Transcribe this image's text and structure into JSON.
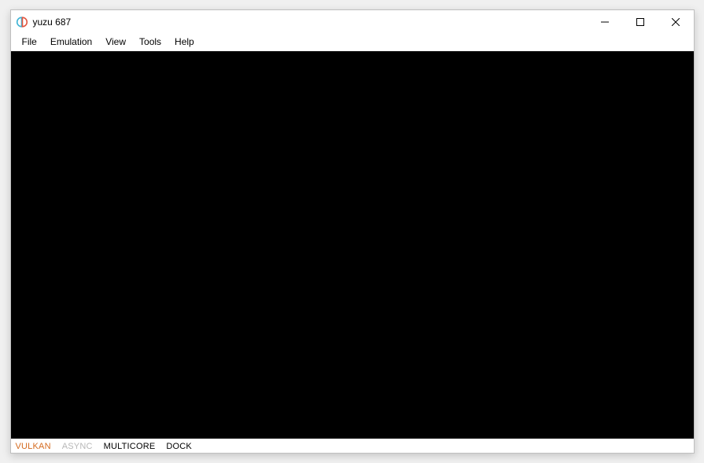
{
  "window": {
    "title": "yuzu 687"
  },
  "menu": {
    "file": "File",
    "emulation": "Emulation",
    "view": "View",
    "tools": "Tools",
    "help": "Help"
  },
  "status": {
    "vulkan": "VULKAN",
    "async": "ASYNC",
    "multicore": "MULTICORE",
    "dock": "DOCK"
  },
  "colors": {
    "vulkan": "#d46a1e",
    "async": "#b7b7b7",
    "text": "#000000",
    "viewport": "#000000",
    "icon_left": "#3fb4d6",
    "icon_right": "#e2553f"
  }
}
